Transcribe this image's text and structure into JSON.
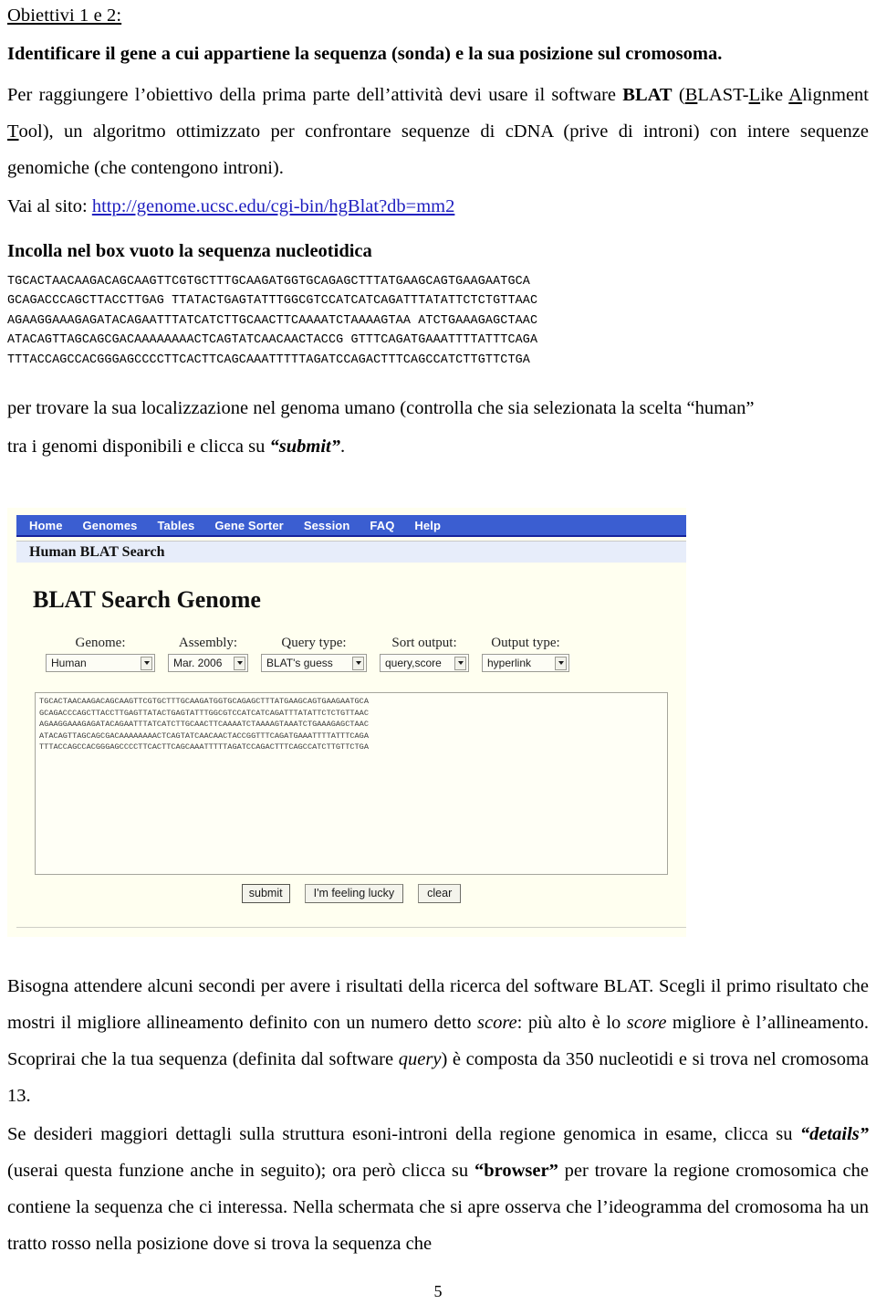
{
  "document": {
    "heading": "Obiettivi 1 e 2:",
    "objective": "Identificare il gene a cui appartiene la sequenza (sonda) e la sua posizione sul cromosoma",
    "objective_tail": ".",
    "paragraph1": {
      "part1": "Per raggiungere l’obiettivo della prima parte dell’attività devi usare il software ",
      "blat_bold": "BLAT",
      "part2": " (",
      "b_underline": "B",
      "part3": "LAST-",
      "l_underline": "L",
      "part4": "ike ",
      "a_underline": "A",
      "part5": "lignment ",
      "t_underline": "T",
      "part6": "ool), un algoritmo ottimizzato per confrontare sequenze di cDNA (prive di introni) con intere sequenze genomiche (che contengono introni)."
    },
    "site_line_label": "Vai al sito: ",
    "site_url": "http://genome.ucsc.edu/cgi-bin/hgBlat?db=mm2",
    "paste_heading": "Incolla nel box vuoto la sequenza nucleotidica",
    "sequence_lines": [
      "TGCACTAACAAGACAGCAAGTTCGTGCTTTGCAAGATGGTGCAGAGCTTTATGAAGCAGTGAAGAATGCA",
      "GCAGACCCAGCTTACCTTGAG TTATACTGAGTATTTGGCGTCCATCATCAGATTTATATTCTCTGTTAAC",
      "AGAAGGAAAGAGATACAGAATTTATCATCTTGCAACTTCAAAATCTAAAAGTAA ATCTGAAAGAGCTAAC",
      "ATACAGTTAGCAGCGACAAAAAAAACTCAGTATCAACAACTACCG GTTTCAGATGAAATTTTATTTCAGA",
      "TTTACCAGCCACGGGAGCCCCTTCACTTCAGCAAATTTTTAGATCCAGACTTTCAGCCATCTTGTTCTGA"
    ],
    "paragraph2": {
      "line1": "per trovare la sua localizzazione nel genoma umano (controlla che sia selezionata la scelta “human”",
      "line2_pre": "tra i genomi disponibili  e clicca su ",
      "line2_emph": "“submit”",
      "line2_post": "."
    },
    "paragraph3": {
      "part1": "Bisogna attendere alcuni secondi per avere i risultati della ricerca del software BLAT. Scegli il primo risultato che mostri il migliore allineamento definito con un numero detto ",
      "score1": "score",
      "part2": ": più alto è lo ",
      "score2": "score",
      "part3": " migliore è l’allineamento. Scoprirai che la tua sequenza (definita dal software ",
      "query": "query",
      "part4": ") è composta da 350 nucleotidi e si trova nel cromosoma 13."
    },
    "paragraph4": {
      "part1": "Se desideri maggiori dettagli sulla struttura esoni-introni della regione genomica in esame, clicca su ",
      "details": "“details”",
      "part2": " (userai questa funzione anche in seguito); ora però clicca su ",
      "browser": "“browser”",
      "part3": " per trovare la regione cromosomica che contiene la sequenza che ci interessa. Nella schermata che si apre osserva che l’ideogramma del cromosoma ha un tratto rosso nella posizione dove si trova la sequenza che"
    },
    "page_number": "5"
  },
  "blat_screenshot": {
    "nav": {
      "items": [
        {
          "label": "Home"
        },
        {
          "label": "Genomes"
        },
        {
          "label": "Tables"
        },
        {
          "label": "Gene Sorter"
        },
        {
          "label": "Session"
        },
        {
          "label": "FAQ"
        },
        {
          "label": "Help"
        }
      ],
      "background": "#3b5ed1"
    },
    "subtitle": "Human BLAT Search",
    "page_title": "BLAT Search Genome",
    "fields": [
      {
        "label": "Genome:",
        "value": "Human"
      },
      {
        "label": "Assembly:",
        "value": "Mar. 2006"
      },
      {
        "label": "Query type:",
        "value": "BLAT's guess"
      },
      {
        "label": "Sort output:",
        "value": "query,score"
      },
      {
        "label": "Output type:",
        "value": "hyperlink"
      }
    ],
    "textarea_lines": [
      "TGCACTAACAAGACAGCAAGTTCGTGCTTTGCAAGATGGTGCAGAGCTTTATGAAGCAGTGAAGAATGCA",
      "GCAGACCCAGCTTACCTTGAGTTATACTGAGTATTTGGCGTCCATCATCAGATTTATATTCTCTGTTAAC",
      "AGAAGGAAAGAGATACAGAATTTATCATCTTGCAACTTCAAAATCTAAAAGTAAATCTGAAAGAGCTAAC",
      "ATACAGTTAGCAGCGACAAAAAAAACTCAGTATCAACAACTACCGGTTTCAGATGAAATTTTATTTCAGA",
      "TTTACCAGCCACGGGAGCCCCTTCACTTCAGCAAATTTTTAGATCCAGACTTTCAGCCATCTTGTTCTGA"
    ],
    "buttons": [
      {
        "label": "submit"
      },
      {
        "label": "I'm feeling lucky"
      },
      {
        "label": "clear"
      }
    ],
    "colors": {
      "nav_blue": "#3b5ed1",
      "nav_border": "#16239b",
      "subbar": "#e7edfa",
      "body_cream": "#fffff0"
    }
  }
}
